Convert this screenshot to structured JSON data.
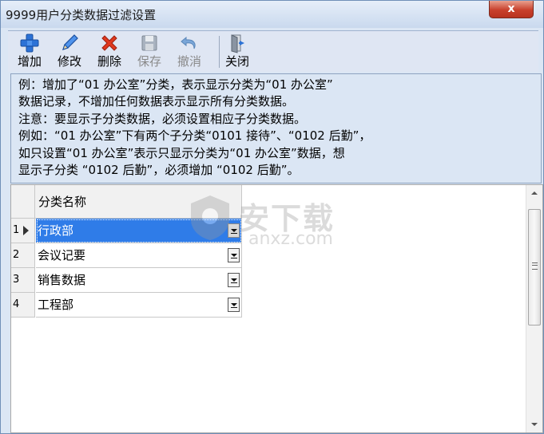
{
  "window": {
    "title": "9999用户分类数据过滤设置",
    "close_label": "x"
  },
  "toolbar": {
    "buttons": [
      {
        "label": "增加",
        "icon": "plus-icon",
        "enabled": true
      },
      {
        "label": "修改",
        "icon": "pencil-icon",
        "enabled": true
      },
      {
        "label": "删除",
        "icon": "delete-x-icon",
        "enabled": true
      },
      {
        "label": "保存",
        "icon": "floppy-disk-icon",
        "enabled": false
      },
      {
        "label": "撤消",
        "icon": "undo-icon",
        "enabled": false
      },
      {
        "label": "关闭",
        "icon": "exit-door-icon",
        "enabled": true
      }
    ]
  },
  "info": {
    "lines": [
      "例：增加了“01 办公室”分类，表示显示分类为“01 办公室”",
      "数据记录，不增加任何数据表示显示所有分类数据。",
      "注意：要显示子分类数据，必须设置相应子分类数据。",
      "例如：“01 办公室”下有两个子分类“0101 接待”、“0102 后勤”，",
      "如只设置“01 办公室”表示只显示分类为“01 办公室”数据，想",
      "显示子分类 “0102 后勤”，必须增加 “0102 后勤”。"
    ]
  },
  "grid": {
    "column_header": "分类名称",
    "rows": [
      {
        "index": "1",
        "value": "行政部",
        "selected": true
      },
      {
        "index": "2",
        "value": "会议记要",
        "selected": false
      },
      {
        "index": "3",
        "value": "销售数据",
        "selected": false
      },
      {
        "index": "4",
        "value": "工程部",
        "selected": false
      }
    ]
  },
  "watermark": {
    "text": "安下载",
    "domain": "anxz.com"
  },
  "colors": {
    "selection": "#2f7ce8",
    "panel_bg": "#dbe6f4",
    "close_button": "#c8402c"
  }
}
